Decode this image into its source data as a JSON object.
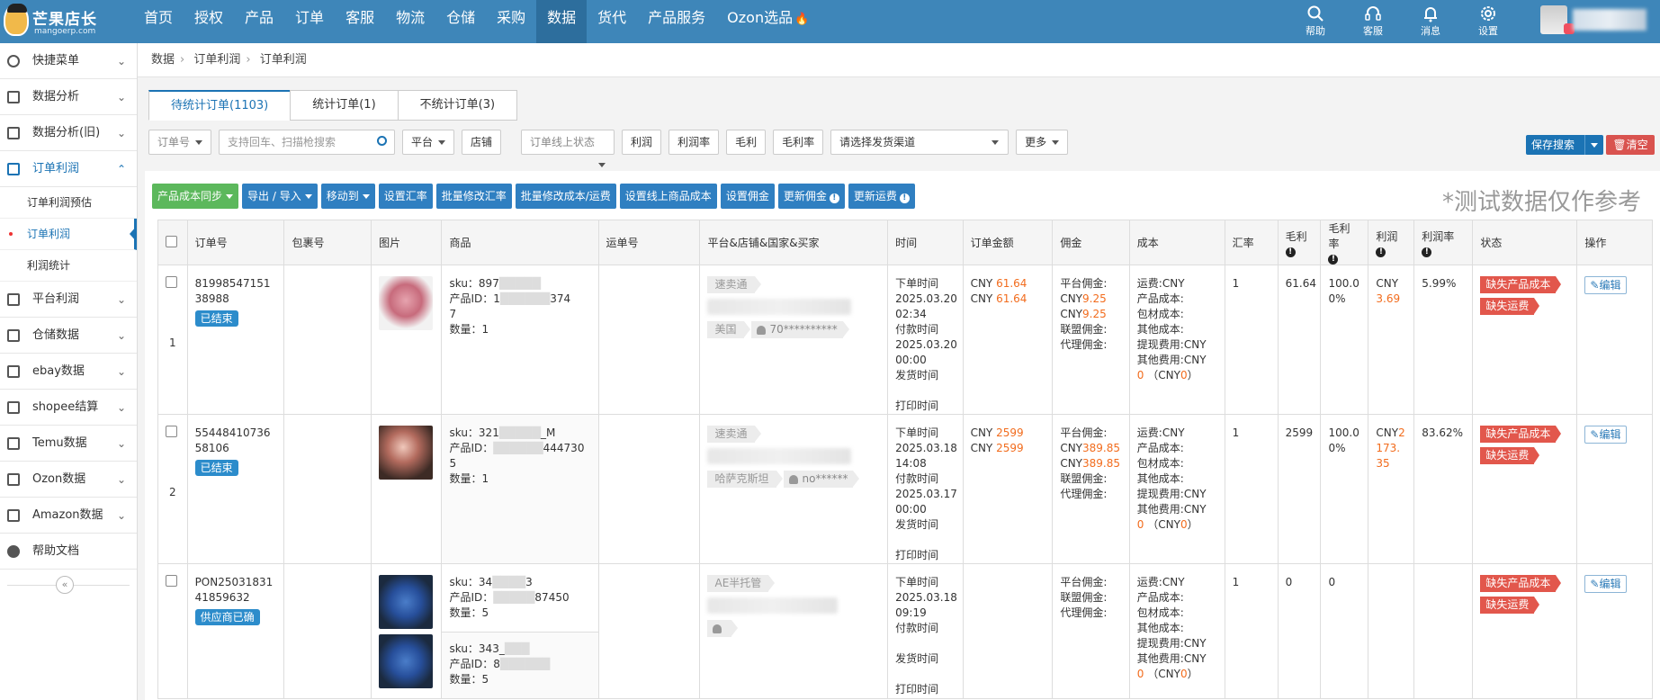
{
  "topbar": {
    "logo_title": "芒果店长",
    "logo_sub": "mangoerp.com",
    "nav": [
      "首页",
      "授权",
      "产品",
      "订单",
      "客服",
      "物流",
      "仓储",
      "采购",
      "数据",
      "货代",
      "产品服务",
      "Ozon选品"
    ],
    "icons": [
      {
        "name": "help-icon",
        "label": "帮助"
      },
      {
        "name": "service-icon",
        "label": "客服"
      },
      {
        "name": "bell-icon",
        "label": "消息"
      },
      {
        "name": "gear-icon",
        "label": "设置"
      }
    ]
  },
  "sidebar": {
    "items": [
      "快捷菜单",
      "数据分析",
      "数据分析(旧)",
      "订单利润",
      "平台利润",
      "仓储数据",
      "ebay数据",
      "shopee结算",
      "Temu数据",
      "Ozon数据",
      "Amazon数据",
      "帮助文档"
    ],
    "sub": [
      "订单利润预估",
      "订单利润",
      "利润统计"
    ],
    "collapse": "«"
  },
  "breadcrumb": [
    "数据",
    "订单利润",
    "订单利润"
  ],
  "tabs": [
    "待统计订单(1103)",
    "统计订单(1)",
    "不统计订单(3)"
  ],
  "filters": {
    "order_no": "订单号",
    "search_placeholder": "支持回车、扫描枪搜索",
    "platform": "平台",
    "store": "店铺",
    "status": "订单线上状态",
    "profit": "利润",
    "profit_rate": "利润率",
    "gross": "毛利",
    "gross_rate": "毛利率",
    "channel": "请选择发货渠道",
    "more": "更多",
    "save": "保存搜索",
    "clear": "清空"
  },
  "actions": {
    "sync": "产品成本同步",
    "export": "导出 / 导入",
    "move": "移动到",
    "rate": "设置汇率",
    "batch_rate": "批量修改汇率",
    "batch_cost": "批量修改成本/运费",
    "online_cost": "设置线上商品成本",
    "commission": "设置佣金",
    "update_commission": "更新佣金",
    "update_freight": "更新运费"
  },
  "watermark": "*测试数据仅作参考",
  "table": {
    "headers": [
      "订单号",
      "包裹号",
      "图片",
      "商品",
      "运单号",
      "平台&店铺&国家&买家",
      "时间",
      "订单金额",
      "佣金",
      "成本",
      "汇率",
      "毛利",
      "毛利率",
      "利润",
      "利润率",
      "状态",
      "操作"
    ],
    "rows": [
      {
        "idx": "1",
        "order_no": "8199854715138988",
        "badge": "已结束",
        "skus": [
          {
            "sku": "sku：897",
            "pid_a": "产品ID：1",
            "pid_b": "374",
            "pid_c": "7",
            "qty": "数量：1"
          }
        ],
        "platform": "速卖通",
        "country": "美国",
        "buyer": "70**********",
        "t1": "下单时间",
        "d1": "2025.03.20",
        "h1": "02:34",
        "t2": "付款时间",
        "d2": "2025.03.20",
        "h2": "00:00",
        "t3": "发货时间",
        "t4": "打印时间",
        "amt_a_lbl": "CNY ",
        "amt_a": "61.64",
        "amt_b_lbl": "CNY ",
        "amt_b": "61.64",
        "comm_lbl": "平台佣金:",
        "comm_c1": "CNY",
        "comm_v1": "9.25",
        "comm_c2": "CNY",
        "comm_v2": "9.25",
        "comm_l2": "联盟佣金:",
        "comm_l3": "代理佣金:",
        "cost": [
          "运费:CNY",
          "产品成本:",
          "包材成本:",
          "其他成本:",
          "提现费用:CNY",
          "其他费用:CNY"
        ],
        "cost_zero": "0",
        "cost_tail": "（CNY",
        "cost_tail_v": "0",
        "cost_tail_end": "）",
        "rate": "1",
        "gross": "61.64",
        "gross_rate_a": "100.0",
        "gross_rate_b": "0%",
        "profit_cur": "CNY",
        "profit_val": "3.69",
        "profit_rate": "5.99%",
        "status1": "缺失产品成本",
        "status2": "缺失运费",
        "edit": "编辑"
      },
      {
        "idx": "2",
        "order_no": "5544841073658106",
        "badge": "已结束",
        "skus": [
          {
            "sku": "sku：321",
            "pid_a": "产品ID：",
            "pid_b": "444730",
            "pid_c": "5",
            "qty": "数量：1",
            "sku_tail": "_M"
          }
        ],
        "platform": "速卖通",
        "country": "哈萨克斯坦",
        "buyer": "no******",
        "t1": "下单时间",
        "d1": "2025.03.18",
        "h1": "14:08",
        "t2": "付款时间",
        "d2": "2025.03.17",
        "h2": "00:00",
        "t3": "发货时间",
        "t4": "打印时间",
        "amt_a_lbl": "CNY ",
        "amt_a": "2599",
        "amt_b_lbl": "CNY ",
        "amt_b": "2599",
        "comm_lbl": "平台佣金:",
        "comm_c1": "CNY",
        "comm_v1": "389.85",
        "comm_c2": "CNY",
        "comm_v2": "389.85",
        "comm_l2": "联盟佣金:",
        "comm_l3": "代理佣金:",
        "cost": [
          "运费:CNY",
          "产品成本:",
          "包材成本:",
          "其他成本:",
          "提现费用:CNY",
          "其他费用:CNY"
        ],
        "cost_zero": "0",
        "cost_tail": "（CNY",
        "cost_tail_v": "0",
        "cost_tail_end": "）",
        "rate": "1",
        "gross": "2599",
        "gross_rate_a": "100.0",
        "gross_rate_b": "0%",
        "profit_cur": "CNY",
        "profit_val": "2173.35",
        "profit_rate": "83.62%",
        "status1": "缺失产品成本",
        "status2": "缺失运费",
        "edit": "编辑"
      },
      {
        "idx": "3",
        "order_no": "PON2503183141859632",
        "badge": "供应商已确",
        "skus": [
          {
            "sku": "sku：34",
            "sku_tail": "3",
            "pid_a": "产品ID：",
            "pid_b": "87450",
            "qty": "数量：5"
          },
          {
            "sku": "sku：343_",
            "pid_a": "产品ID：8",
            "qty": "数量：5"
          }
        ],
        "platform": "AE半托管",
        "country": "",
        "buyer": "",
        "t1": "下单时间",
        "d1": "2025.03.18",
        "h1": "09:19",
        "t2": "付款时间",
        "t3": "发货时间",
        "t4": "打印时间",
        "comm_lbl": "平台佣金:",
        "comm_l2": "联盟佣金:",
        "comm_l3": "代理佣金:",
        "cost": [
          "运费:CNY",
          "产品成本:",
          "包材成本:",
          "其他成本:",
          "提现费用:CNY",
          "其他费用:CNY"
        ],
        "cost_zero": "0",
        "cost_tail": "（CNY",
        "cost_tail_v": "0",
        "cost_tail_end": "）",
        "rate": "1",
        "gross": "0",
        "gross_rate_a": "0",
        "status1": "缺失产品成本",
        "status2": "缺失运费",
        "edit": "编辑"
      }
    ]
  }
}
